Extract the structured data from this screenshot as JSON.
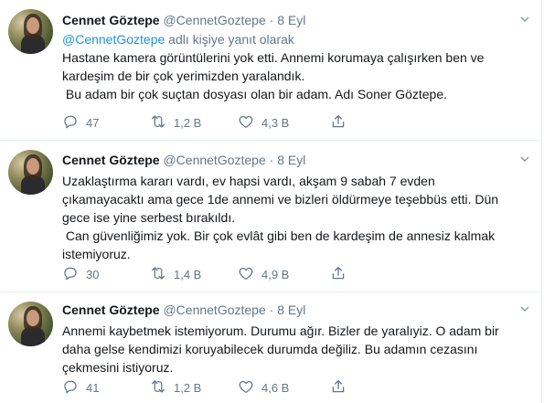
{
  "tweets": [
    {
      "author_name": "Cennet Göztepe",
      "handle": "@CennetGoztepe",
      "dot": "·",
      "date": "8 Eyl",
      "reply_handle": "@CennetGoztepe",
      "reply_suffix": " adlı kişiye yanıt olarak",
      "text": "Hastane kamera görüntülerini yok etti. Annemi korumaya çalışırken ben ve\nkardeşim de bir çok yerimizden yaralandık.\n Bu adam bir çok suçtan dosyası olan bir adam. Adı Soner Göztepe.",
      "replies": "47",
      "retweets": "1,2 B",
      "likes": "4,3 B"
    },
    {
      "author_name": "Cennet Göztepe",
      "handle": "@CennetGoztepe",
      "dot": "·",
      "date": "8 Eyl",
      "text": "Uzaklaştırma kararı vardı, ev hapsi vardı, akşam 9 sabah 7 evden\nçıkamayacaktı ama gece 1de annemi ve bizleri öldürmeye teşebbüs etti. Dün\ngece ise yine serbest bırakıldı.\n Can güvenliğimiz yok. Bir çok evlât gibi ben de kardeşim de annesiz kalmak\nistemiyoruz.",
      "replies": "30",
      "retweets": "1,4 B",
      "likes": "4,9 B"
    },
    {
      "author_name": "Cennet Göztepe",
      "handle": "@CennetGoztepe",
      "dot": "·",
      "date": "8 Eyl",
      "text": "Annemi kaybetmek istemiyorum. Durumu ağır. Bizler de yaralıyiz. O adam bir\ndaha gelse kendimizi koruyabilecek durumda değiliz. Bu adamın cezasını\nçekmesini istiyoruz.",
      "replies": "41",
      "retweets": "1,2 B",
      "likes": "4,6 B"
    }
  ],
  "icons": {
    "reply": "reply-icon",
    "retweet": "retweet-icon",
    "like": "heart-icon",
    "share": "share-icon",
    "menu": "chevron-down-icon"
  },
  "colors": {
    "text": "#14171a",
    "muted": "#657786",
    "link": "#1b95e0",
    "divider": "#e6ecf0"
  }
}
